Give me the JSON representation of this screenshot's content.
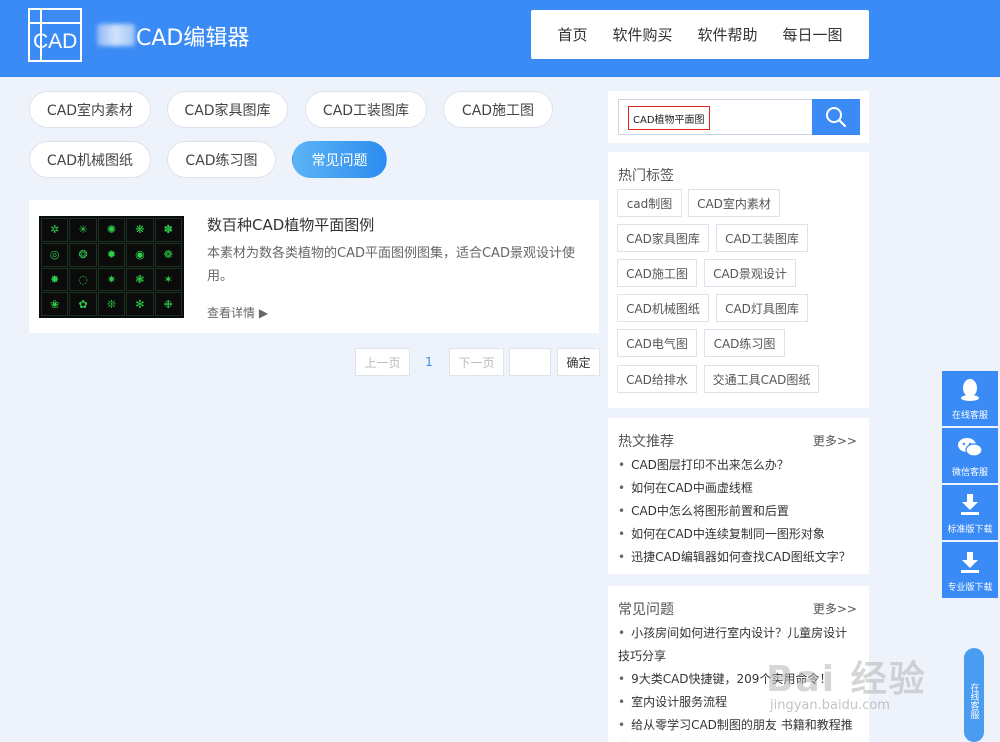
{
  "header": {
    "logo_text": "CAD",
    "site_name": "CAD编辑器",
    "nav": [
      "首页",
      "软件购买",
      "软件帮助",
      "每日一图"
    ]
  },
  "categories": [
    {
      "label": "CAD室内素材",
      "active": false
    },
    {
      "label": "CAD家具图库",
      "active": false
    },
    {
      "label": "CAD工装图库",
      "active": false
    },
    {
      "label": "CAD施工图",
      "active": false
    },
    {
      "label": "CAD机械图纸",
      "active": false
    },
    {
      "label": "CAD练习图",
      "active": false
    },
    {
      "label": "常见问题",
      "active": true
    }
  ],
  "article": {
    "title": "数百种CAD植物平面图例",
    "description": "本素材为数各类植物的CAD平面图例图集，适合CAD景观设计使用。",
    "more": "查看详情 ▶"
  },
  "pagination": {
    "prev": "上一页",
    "current": "1",
    "next": "下一页",
    "input_value": "",
    "confirm": "确定"
  },
  "search": {
    "value": "CAD植物平面图",
    "icon": "search-icon"
  },
  "hot_tags": {
    "title": "热门标签",
    "tags": [
      "cad制图",
      "CAD室内素材",
      "CAD家具图库",
      "CAD工装图库",
      "CAD施工图",
      "CAD景观设计",
      "CAD机械图纸",
      "CAD灯具图库",
      "CAD电气图",
      "CAD练习图",
      "CAD给排水",
      "交通工具CAD图纸"
    ]
  },
  "hot_articles": {
    "title": "热文推荐",
    "more": "更多>>",
    "items": [
      "CAD图层打印不出来怎么办？",
      "如何在CAD中画虚线框",
      "CAD中怎么将图形前置和后置",
      "如何在CAD中连续复制同一图形对象",
      "迅捷CAD编辑器如何查找CAD图纸文字？"
    ]
  },
  "faq": {
    "title": "常见问题",
    "more": "更多>>",
    "items": [
      "小孩房间如何进行室内设计？儿童房设计技巧分享",
      "9大类CAD快捷键，209个实用命令！",
      "室内设计服务流程",
      "给从零学习CAD制图的朋友 书籍和教程推荐"
    ]
  },
  "float_bar": [
    {
      "label": "在线客服",
      "icon": "qq-icon"
    },
    {
      "label": "微信客服",
      "icon": "wechat-icon"
    },
    {
      "label": "标准版下载",
      "icon": "download-icon"
    },
    {
      "label": "专业版下载",
      "icon": "download-icon"
    }
  ],
  "float_chat": "在线客服",
  "watermark": {
    "main": "Bai 经验",
    "sub": "jingyan.baidu.com"
  },
  "colors": {
    "brand": "#3a8bf5",
    "active_pill": "#2d8cf0",
    "search_highlight": "#e1251b"
  }
}
